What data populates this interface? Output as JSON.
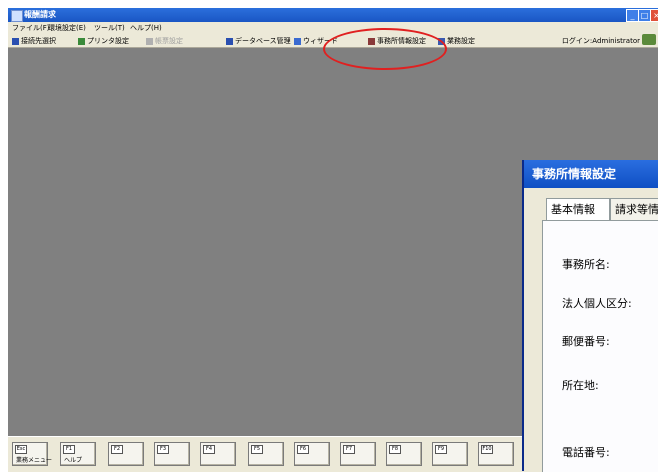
{
  "window": {
    "title": "報酬請求"
  },
  "menu": [
    "ファイル(F)",
    "環境設定(E)",
    "ツール(T)",
    "ヘルプ(H)"
  ],
  "toolbar": {
    "items": [
      {
        "label": "接続先選択"
      },
      {
        "label": "プリンタ設定"
      },
      {
        "label": "帳票設定"
      },
      {
        "label": "データベース管理"
      },
      {
        "label": "ウィザード"
      },
      {
        "label": "事務所情報設定"
      },
      {
        "label": "業務設定"
      }
    ],
    "login": "ログイン:Administrator"
  },
  "fkeys": [
    {
      "key": "Esc",
      "label": "業務メニュー"
    },
    {
      "key": "F1",
      "label": "ヘルプ"
    },
    {
      "key": "F2",
      "label": ""
    },
    {
      "key": "F3",
      "label": ""
    },
    {
      "key": "F4",
      "label": ""
    },
    {
      "key": "F5",
      "label": ""
    },
    {
      "key": "F6",
      "label": ""
    },
    {
      "key": "F7",
      "label": ""
    },
    {
      "key": "F8",
      "label": ""
    },
    {
      "key": "F9",
      "label": ""
    },
    {
      "key": "F10",
      "label": ""
    }
  ],
  "dialog": {
    "title": "事務所情報設定",
    "tabs": [
      "基本情報",
      "請求等情"
    ],
    "fields": [
      "事務所名:",
      "法人個人区分:",
      "郵便番号:",
      "所在地:",
      "電話番号:"
    ]
  },
  "colors": {
    "workspace": "#808080",
    "annotation": "#e02020",
    "titlebar": "#1a56c4"
  }
}
